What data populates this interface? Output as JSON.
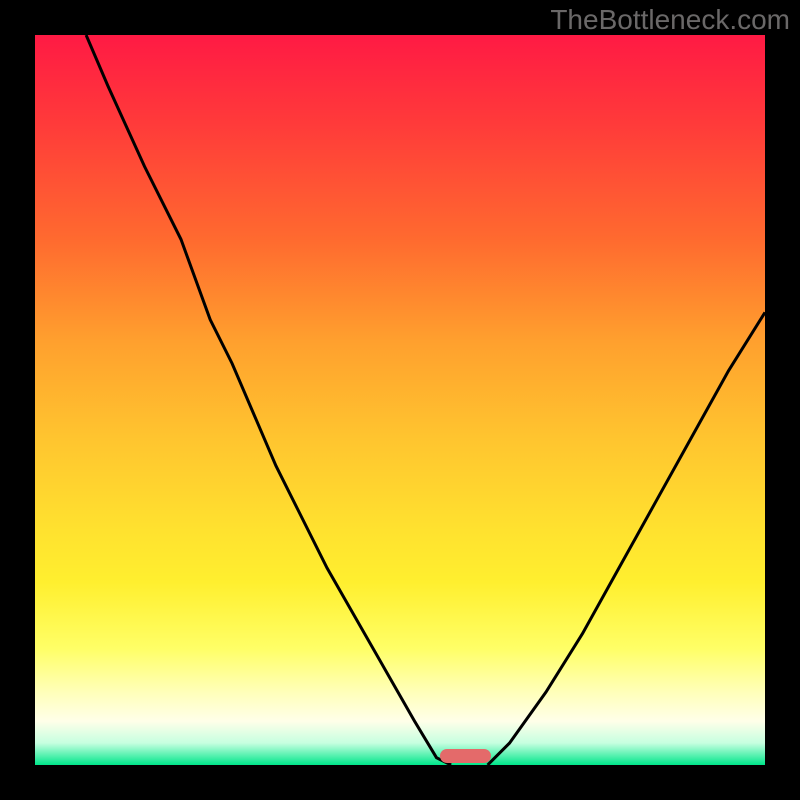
{
  "watermark": "TheBottleneck.com",
  "chart_data": {
    "type": "line",
    "title": "",
    "subtitle": "",
    "xlabel": "",
    "ylabel": "",
    "xlim": [
      0,
      100
    ],
    "ylim": [
      0,
      100
    ],
    "grid": false,
    "legend": false,
    "series": [
      {
        "name": "left-curve",
        "x": [
          7,
          10,
          15,
          20,
          24,
          27,
          30,
          33,
          36,
          40,
          44,
          48,
          52,
          55,
          57
        ],
        "values": [
          100,
          93,
          82,
          72,
          61,
          55,
          48,
          41,
          35,
          27,
          20,
          13,
          6,
          1,
          0
        ]
      },
      {
        "name": "right-curve",
        "x": [
          62,
          65,
          70,
          75,
          80,
          85,
          90,
          95,
          100
        ],
        "values": [
          0,
          3,
          10,
          18,
          27,
          36,
          45,
          54,
          62
        ]
      }
    ],
    "marker": {
      "name": "optimal-zone",
      "x_center": 59,
      "width": 7,
      "y": 0.5,
      "color": "#e46a6a"
    },
    "background_gradient": {
      "top_color": "#ff1a44",
      "bottom_color": "#00e68a"
    }
  }
}
